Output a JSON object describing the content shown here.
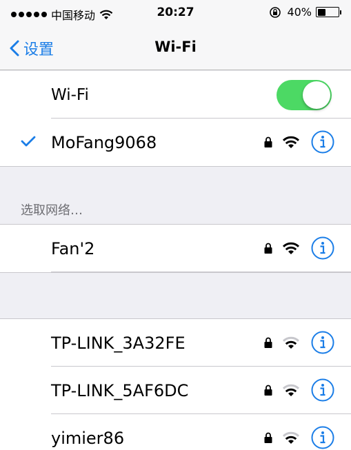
{
  "status_bar": {
    "carrier": "中国移动",
    "time": "20:27",
    "battery_percent": "40%",
    "battery_level": 0.4
  },
  "nav": {
    "back_label": "设置",
    "title": "Wi-Fi"
  },
  "wifi_toggle": {
    "label": "Wi-Fi",
    "on": true
  },
  "connected_network": {
    "name": "MoFang9068",
    "secured": true,
    "signal_bars": 3
  },
  "section_header": "选取网络…",
  "networks": [
    {
      "name": "Fan'2",
      "secured": true,
      "signal_bars": 3
    },
    {
      "name": "TP-LINK_3A32FE",
      "secured": true,
      "signal_bars": 2
    },
    {
      "name": "TP-LINK_5AF6DC",
      "secured": true,
      "signal_bars": 2
    },
    {
      "name": "yimier86",
      "secured": true,
      "signal_bars": 2
    }
  ],
  "colors": {
    "accent": "#1a7de7",
    "toggle_on": "#4cd964",
    "background": "#efeff4",
    "signal_dim": "#c7c7cc"
  }
}
